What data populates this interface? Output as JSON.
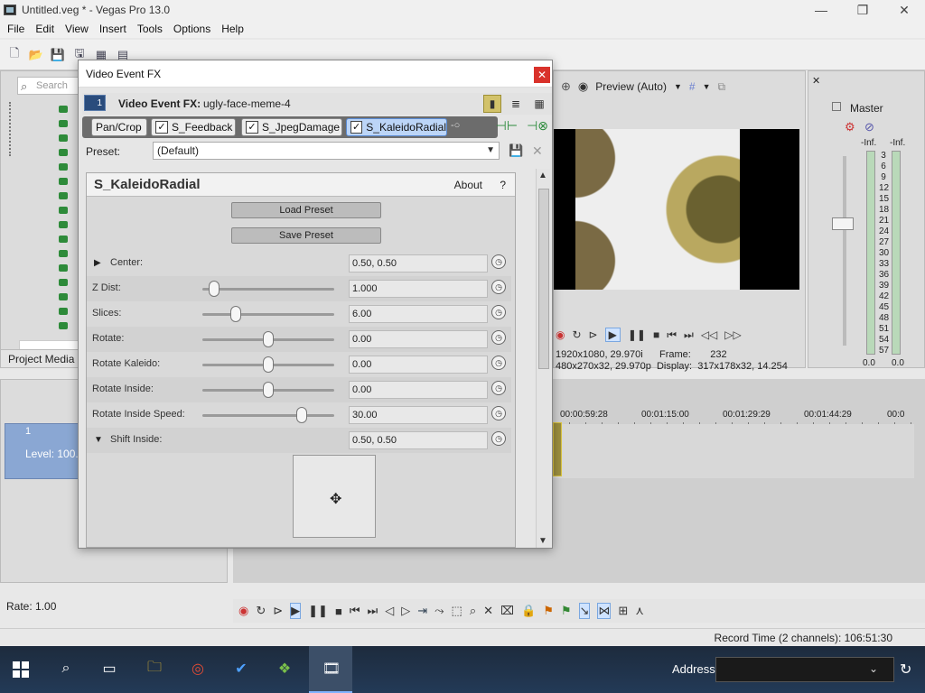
{
  "window": {
    "title": "Untitled.veg * - Vegas Pro 13.0",
    "controls": [
      "—",
      "❐",
      "✕"
    ]
  },
  "menu": [
    "File",
    "Edit",
    "View",
    "Insert",
    "Tools",
    "Options",
    "Help"
  ],
  "left_panel": {
    "search_placeholder": "Search",
    "tab": "Project Media"
  },
  "preview": {
    "mode": "Preview (Auto)",
    "info_line1": "1920x1080, 29.970i",
    "info_line2": "480x270x32, 29.970p",
    "frame_label": "Frame:",
    "frame_value": "232",
    "display_label": "Display:",
    "display_value": "317x178x32, 14.254"
  },
  "master": {
    "label": "Master",
    "left_inf": "-Inf.",
    "right_inf": "-Inf.",
    "scale": [
      "3",
      "6",
      "9",
      "12",
      "15",
      "18",
      "21",
      "24",
      "27",
      "30",
      "33",
      "36",
      "39",
      "42",
      "45",
      "48",
      "51",
      "54",
      "57"
    ],
    "left_bottom": "0.0",
    "right_bottom": "0.0"
  },
  "timeline": {
    "track_level": "Level: 100.0",
    "track_number": "1",
    "rate": "Rate: 1.00",
    "ruler": [
      "00:00:59:28",
      "00:01:15:00",
      "00:01:29:29",
      "00:01:44:29",
      "00:0"
    ]
  },
  "status": {
    "record_time": "Record Time (2 channels): 106:51:30"
  },
  "taskbar": {
    "address_label": "Address"
  },
  "fx_dialog": {
    "title": "Video Event FX",
    "close": "✕",
    "header_label": "Video Event FX:",
    "header_value": "ugly-face-meme-4",
    "track_icon_num": "1",
    "chain": [
      {
        "name": "Pan/Crop",
        "checked": false
      },
      {
        "name": "S_Feedback",
        "checked": true
      },
      {
        "name": "S_JpegDamage",
        "checked": true
      },
      {
        "name": "S_KaleidoRadial",
        "checked": true,
        "selected": true
      }
    ],
    "preset_label": "Preset:",
    "preset_value": "(Default)",
    "plugin_name": "S_KaleidoRadial",
    "about": "About",
    "help": "?",
    "load_preset": "Load Preset",
    "save_preset": "Save Preset",
    "params": [
      {
        "label": "Center:",
        "value": "0.50, 0.50",
        "type": "expand"
      },
      {
        "label": "Z Dist:",
        "value": "1.000",
        "type": "slider",
        "pos": 0.09
      },
      {
        "label": "Slices:",
        "value": "6.00",
        "type": "slider",
        "pos": 0.25
      },
      {
        "label": "Rotate:",
        "value": "0.00",
        "type": "slider",
        "pos": 0.5
      },
      {
        "label": "Rotate Kaleido:",
        "value": "0.00",
        "type": "slider",
        "pos": 0.5
      },
      {
        "label": "Rotate Inside:",
        "value": "0.00",
        "type": "slider",
        "pos": 0.5
      },
      {
        "label": "Rotate Inside Speed:",
        "value": "30.00",
        "type": "slider",
        "pos": 0.75
      },
      {
        "label": "Shift Inside:",
        "value": "0.50, 0.50",
        "type": "expanded"
      }
    ]
  }
}
